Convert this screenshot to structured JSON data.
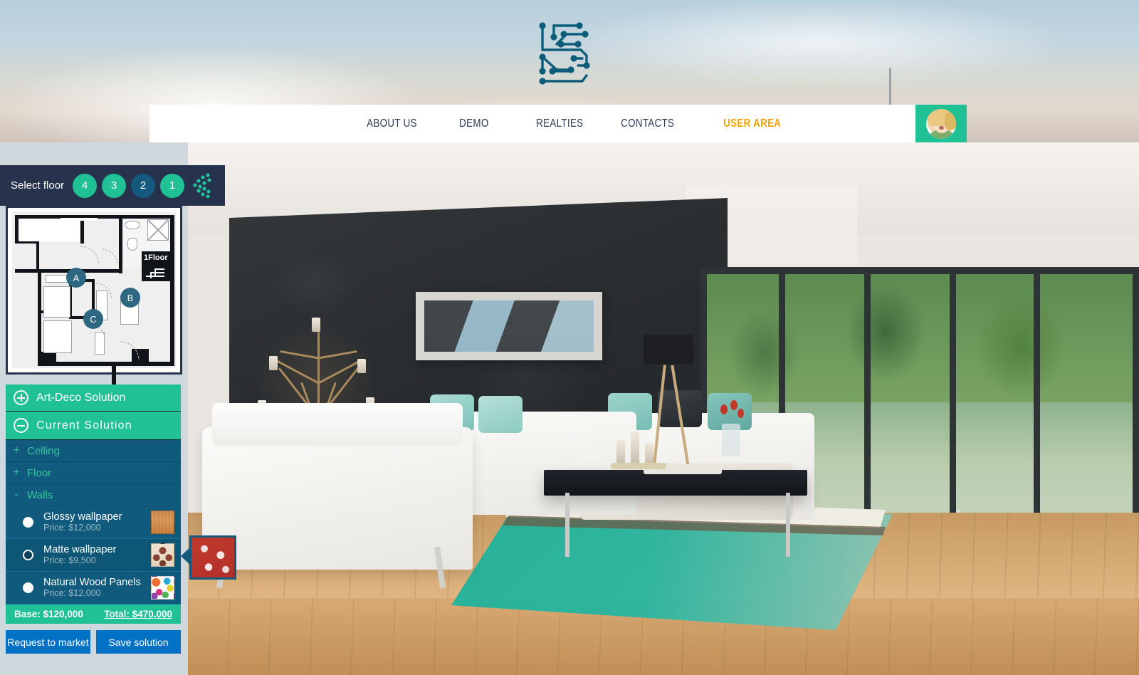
{
  "brand": {
    "logo_icon": "circuit-s-logo",
    "accent_green": "#1fc195",
    "accent_blue": "#0072c6",
    "navy": "#27334d",
    "teal": "#0f5a7d",
    "user_area_orange": "#f5a300"
  },
  "nav": {
    "items": [
      {
        "label": "ABOUT US",
        "name": "nav-about-us"
      },
      {
        "label": "DEMO",
        "name": "nav-demo"
      },
      {
        "label": "REALTIES",
        "name": "nav-realties"
      },
      {
        "label": "CONTACTS",
        "name": "nav-contacts"
      },
      {
        "label": "USER AREA",
        "name": "nav-user-area"
      }
    ],
    "avatar_icon": "user-avatar"
  },
  "floor_selector": {
    "label": "Select floor",
    "floors": [
      {
        "label": "4",
        "selected": false
      },
      {
        "label": "3",
        "selected": false
      },
      {
        "label": "2",
        "selected": true
      },
      {
        "label": "1",
        "selected": false
      }
    ],
    "collapse_icon": "chevron-left-dots-icon"
  },
  "floorplan": {
    "floor_badge": "1Floor",
    "markers": [
      {
        "label": "A"
      },
      {
        "label": "B"
      },
      {
        "label": "C"
      }
    ]
  },
  "solutions": [
    {
      "label": "Art-Deco Solution",
      "expanded": false,
      "icon": "plus-circle-icon"
    },
    {
      "label": "Current  Solution",
      "expanded": true,
      "icon": "minus-circle-icon"
    }
  ],
  "categories": [
    {
      "label": "Celling",
      "sign": "+",
      "expanded": false
    },
    {
      "label": "Floor",
      "sign": "+",
      "expanded": false
    },
    {
      "label": "Walls",
      "sign": "-",
      "expanded": true
    }
  ],
  "materials": [
    {
      "name": "Glossy wallpaper",
      "price": "Price: $12,000",
      "selected": false,
      "swatch": "wood-grain-swatch"
    },
    {
      "name": "Matte wallpaper",
      "price": "Price: $9,500",
      "selected": true,
      "swatch": "damask-swatch"
    },
    {
      "name": "Natural Wood Panels",
      "price": "Price: $12,000",
      "selected": false,
      "swatch": "graffiti-swatch"
    }
  ],
  "totals": {
    "base": "Base: $120,000",
    "total": "Total: $470,000"
  },
  "actions": [
    {
      "label": "Request to market",
      "name": "request-to-market-button"
    },
    {
      "label": "Save solution",
      "name": "save-solution-button"
    }
  ],
  "preview": {
    "icon": "material-preview-swatch"
  }
}
